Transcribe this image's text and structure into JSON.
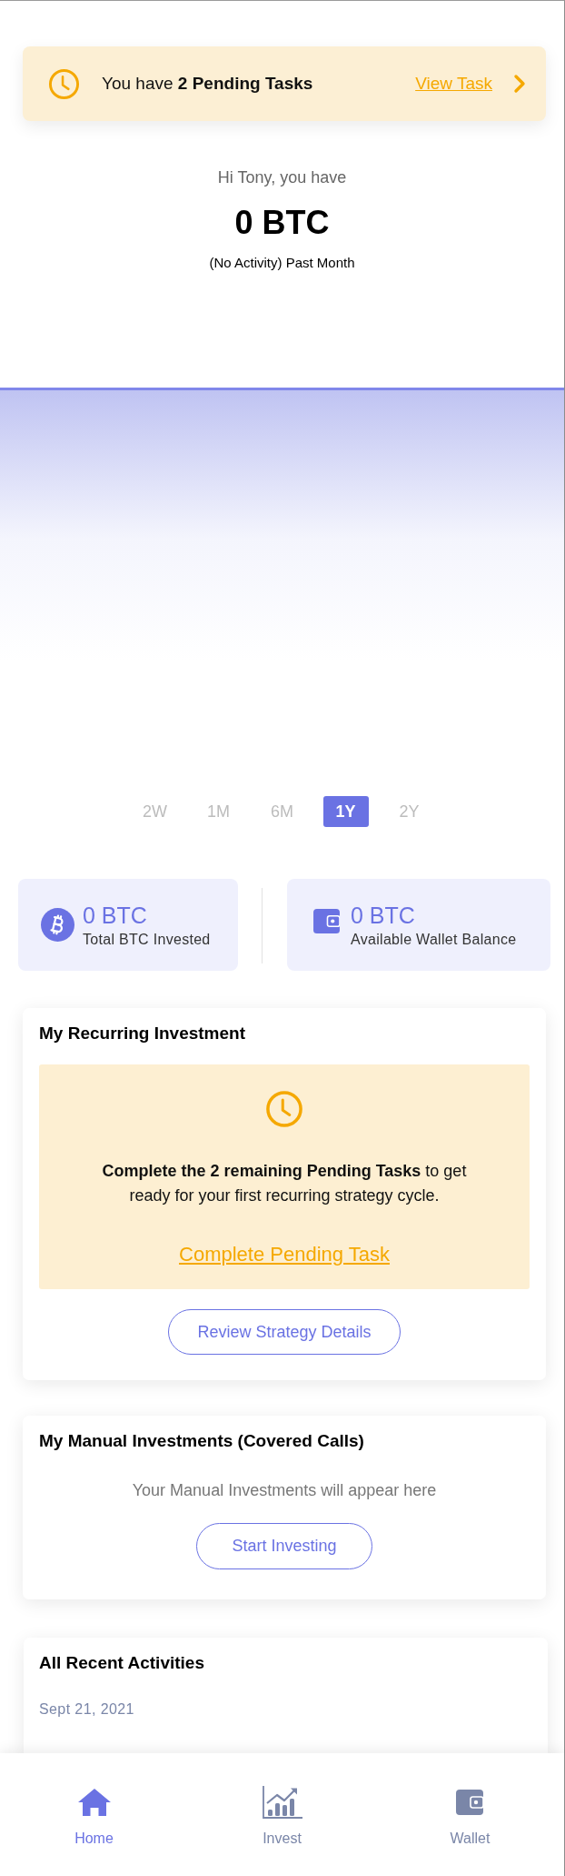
{
  "pending_banner": {
    "text": "You have **2 Pending Tasks**",
    "link": "View Task"
  },
  "summary": {
    "greeting": "Hi Tony, you have",
    "balance": "0 BTC",
    "caption": "(No Activity) Past Month"
  },
  "range_tabs": [
    {
      "label": "2W",
      "selected": false
    },
    {
      "label": "1M",
      "selected": false
    },
    {
      "label": "6M",
      "selected": false
    },
    {
      "label": "1Y",
      "selected": true
    },
    {
      "label": "2Y",
      "selected": false
    }
  ],
  "stats": [
    {
      "kind": "bitcoin",
      "value": "0 BTC",
      "label": "Total BTC Invested"
    },
    {
      "kind": "wallet",
      "value": "0 BTC",
      "label": "Available Wallet Balance"
    }
  ],
  "recurring_investment": {
    "title": "My Recurring Investment",
    "notice": {
      "message": "**Complete the 2 remaining Pending Tasks** to get ready for your first recurring strategy cycle.",
      "link": "Complete Pending Task"
    },
    "button": "Review Strategy Details"
  },
  "manual_investments": {
    "title": "My Manual Investments (Covered Calls)",
    "empty_text": "Your Manual Investments will appear here",
    "button": "Start Investing"
  },
  "recent_activities": {
    "title": "All Recent Activities",
    "groups": [
      {
        "date": "Sept 21, 2021"
      }
    ]
  },
  "bottom_nav": [
    {
      "kind": "home",
      "label": "Home",
      "selected": true
    },
    {
      "kind": "invest",
      "label": "Invest",
      "selected": false
    },
    {
      "kind": "wallet",
      "label": "Wallet",
      "selected": false
    }
  ]
}
